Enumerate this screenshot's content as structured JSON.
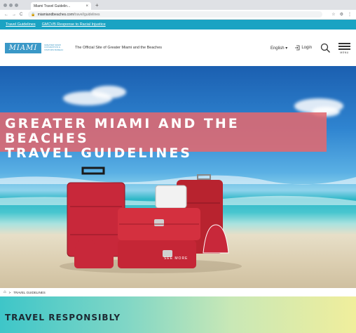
{
  "browser": {
    "tab_title": "Miami Travel Guidelin...",
    "tab_close": "×",
    "new_tab": "+",
    "url_domain": "miamiandbeaches.com",
    "url_path": "/travel/guidelines",
    "nav_back": "←",
    "nav_forward": "→",
    "nav_reload": "C",
    "right_controls": [
      "☆",
      "⚙",
      "⋮"
    ]
  },
  "utility_links": [
    "Travel Guidelines",
    "GMCVB Response to Racial Injustice"
  ],
  "header": {
    "logo_text": "MIAMI",
    "logo_sub": "GREATER MIAMI CONVENTION & VISITORS BUREAU",
    "tagline": "The Official Site of Greater Miami and the Beaches",
    "language": "English ▾",
    "login": "Login",
    "menu_label": "MENU"
  },
  "hero": {
    "title_line1": "GREATER MIAMI AND THE BEACHES",
    "title_line2": "TRAVEL GUIDELINES",
    "see_more": "SEE MORE"
  },
  "breadcrumb": {
    "home_icon": "⌂",
    "separator": ">",
    "current": "TRAVEL GUIDELINES"
  },
  "section": {
    "title": "TRAVEL RESPONSIBLY"
  },
  "colors": {
    "utility_bar": "#1aa3c3",
    "title_box": "#e1696f",
    "logo": "#3a98c7",
    "luggage": "#c8283a"
  }
}
